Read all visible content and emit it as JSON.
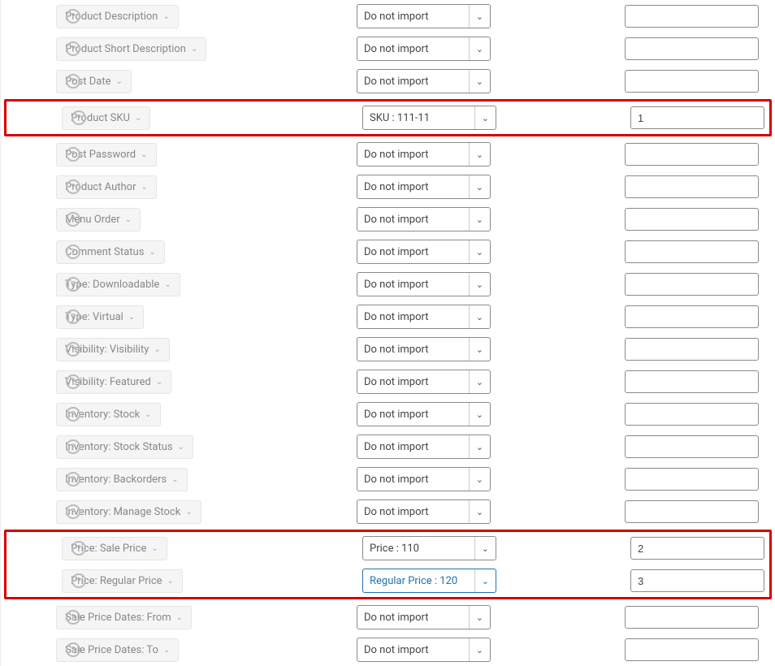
{
  "rows": [
    {
      "field": "Product Description",
      "select": "Do not import",
      "value": "",
      "active": false
    },
    {
      "field": "Product Short Description",
      "select": "Do not import",
      "value": "",
      "active": false
    },
    {
      "field": "Post Date",
      "select": "Do not import",
      "value": "",
      "active": false
    },
    {
      "field": "Product SKU",
      "select": "SKU  :  111-11",
      "value": "1",
      "active": false,
      "highlight": true
    },
    {
      "field": "Post Password",
      "select": "Do not import",
      "value": "",
      "active": false
    },
    {
      "field": "Product Author",
      "select": "Do not import",
      "value": "",
      "active": false
    },
    {
      "field": "Menu Order",
      "select": "Do not import",
      "value": "",
      "active": false
    },
    {
      "field": "Comment Status",
      "select": "Do not import",
      "value": "",
      "active": false
    },
    {
      "field": "Type: Downloadable",
      "select": "Do not import",
      "value": "",
      "active": false
    },
    {
      "field": "Type: Virtual",
      "select": "Do not import",
      "value": "",
      "active": false
    },
    {
      "field": "Visibility: Visibility",
      "select": "Do not import",
      "value": "",
      "active": false
    },
    {
      "field": "Visibility: Featured",
      "select": "Do not import",
      "value": "",
      "active": false
    },
    {
      "field": "Inventory: Stock",
      "select": "Do not import",
      "value": "",
      "active": false
    },
    {
      "field": "Inventory: Stock Status",
      "select": "Do not import",
      "value": "",
      "active": false
    },
    {
      "field": "Inventory: Backorders",
      "select": "Do not import",
      "value": "",
      "active": false
    },
    {
      "field": "Inventory: Manage Stock",
      "select": "Do not import",
      "value": "",
      "active": false
    },
    {
      "field": "Price: Sale Price",
      "select": "Price  :  110",
      "value": "2",
      "active": false,
      "highlight_group": "price"
    },
    {
      "field": "Price: Regular Price",
      "select": "Regular Price  :  120",
      "value": "3",
      "active": true,
      "highlight_group": "price"
    },
    {
      "field": "Sale Price Dates: From",
      "select": "Do not import",
      "value": "",
      "active": false
    },
    {
      "field": "Sale Price Dates: To",
      "select": "Do not import",
      "value": "",
      "active": false
    }
  ]
}
